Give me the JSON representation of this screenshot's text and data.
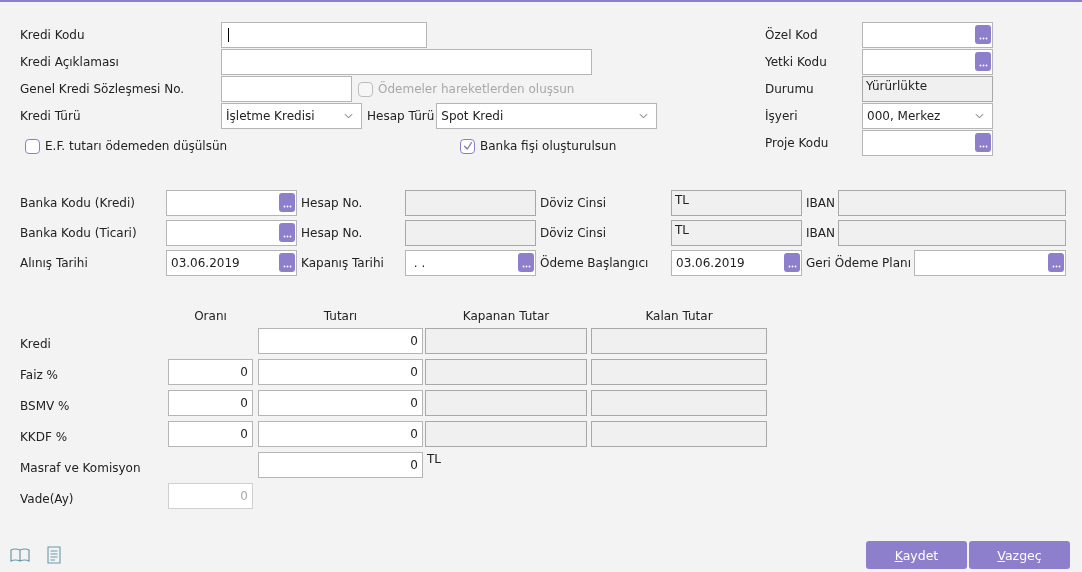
{
  "general": {
    "kredi_kodu": {
      "label": "Kredi Kodu",
      "focused": true
    },
    "kredi_aciklamasi": {
      "label": "Kredi Açıklaması"
    },
    "sozlesme_no": {
      "label": "Genel Kredi Sözleşmesi No."
    },
    "odemeler_hareketlerden": {
      "label": "Ödemeler hareketlerden oluşsun",
      "checked": false,
      "disabled": true
    },
    "kredi_turu": {
      "label": "Kredi Türü",
      "value": "İşletme Kredisi"
    },
    "hesap_turu": {
      "label": "Hesap Türü",
      "value": "Spot Kredi"
    },
    "ef_tutari": {
      "label": "E.F. tutarı ödemeden düşülsün",
      "checked": false,
      "disabled": false
    },
    "banka_fisi": {
      "label": "Banka fişi oluşturulsun",
      "checked": true,
      "disabled": false
    }
  },
  "side": [
    {
      "label": "Özel Kod",
      "kind": "lookup"
    },
    {
      "label": "Yetki Kodu",
      "kind": "lookup"
    },
    {
      "label": "Durumu",
      "kind": "readonly",
      "value": "Yürürlükte"
    },
    {
      "label": "İşyeri",
      "kind": "select",
      "value": "000, Merkez"
    },
    {
      "label": "Proje Kodu",
      "kind": "lookup"
    }
  ],
  "bank_rows": [
    [
      {
        "label": "Banka Kodu (Kredi)",
        "kind": "lookup"
      },
      {
        "label": "Hesap No.",
        "kind": "readonly"
      },
      {
        "label": "Döviz Cinsi",
        "kind": "readonly",
        "value": "TL"
      },
      {
        "label": "IBAN",
        "kind": "readonly"
      }
    ],
    [
      {
        "label": "Banka Kodu (Ticari)",
        "kind": "lookup"
      },
      {
        "label": "Hesap No.",
        "kind": "readonly"
      },
      {
        "label": "Döviz Cinsi",
        "kind": "readonly",
        "value": "TL"
      },
      {
        "label": "IBAN",
        "kind": "readonly"
      }
    ],
    [
      {
        "label": "Alınış Tarihi",
        "kind": "lookup",
        "value": "03.06.2019"
      },
      {
        "label": "Kapanış Tarihi",
        "kind": "lookup",
        "value": " . ."
      },
      {
        "label": "Ödeme Başlangıcı",
        "kind": "lookup",
        "value": "03.06.2019"
      },
      {
        "label": "Geri Ödeme Planı",
        "kind": "lookup"
      }
    ]
  ],
  "amounts": {
    "columns": [
      "Oranı",
      "Tutarı",
      "Kapanan Tutar",
      "Kalan Tutar"
    ],
    "rows": [
      {
        "label": "Kredi",
        "kind": "balance",
        "amount": "0"
      },
      {
        "label": "Faiz %",
        "kind": "rate",
        "rate": "0",
        "amount": "0"
      },
      {
        "label": "BSMV %",
        "kind": "rate",
        "rate": "0",
        "amount": "0"
      },
      {
        "label": "KKDF %",
        "kind": "rate",
        "rate": "0",
        "amount": "0"
      },
      {
        "label": "Masraf ve Komisyon",
        "kind": "fee",
        "amount": "0",
        "unit": "TL"
      },
      {
        "label": "Vade(Ay)",
        "kind": "term",
        "rate": "0"
      }
    ]
  },
  "buttons": [
    "Kaydet",
    "Vazgeç"
  ]
}
